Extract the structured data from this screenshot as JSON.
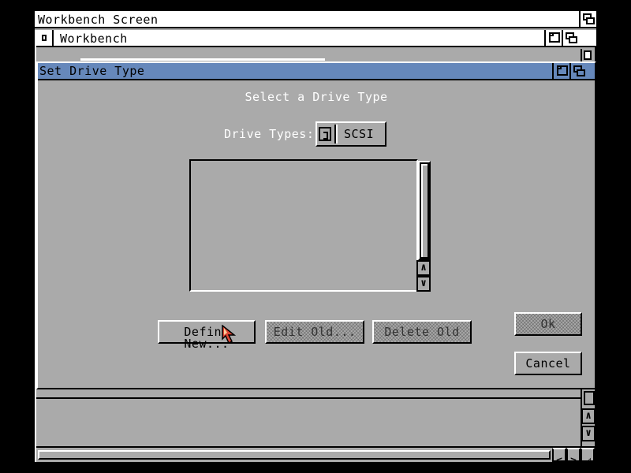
{
  "screen": {
    "title": "Workbench Screen"
  },
  "workbench_window": {
    "title": "Workbench"
  },
  "dialog": {
    "title": "Set Drive Type",
    "heading": "Select a Drive Type",
    "drive_types_label": "Drive Types:",
    "drive_types_value": "SCSI",
    "drive_list_items": [],
    "buttons": {
      "define_new": "Define New...",
      "edit_old": "Edit Old...",
      "delete_old": "Delete Old",
      "ok": "Ok",
      "cancel": "Cancel"
    }
  },
  "icons": {
    "scroll_up": "∧",
    "scroll_down": "∨",
    "scroll_left": "<",
    "scroll_right": ">",
    "resize": "◿"
  },
  "colors": {
    "background": "#aaaaaa",
    "active_title": "#6688bb",
    "highlight": "#ffffff",
    "shadow": "#000000",
    "pointer": "#dd4433"
  }
}
